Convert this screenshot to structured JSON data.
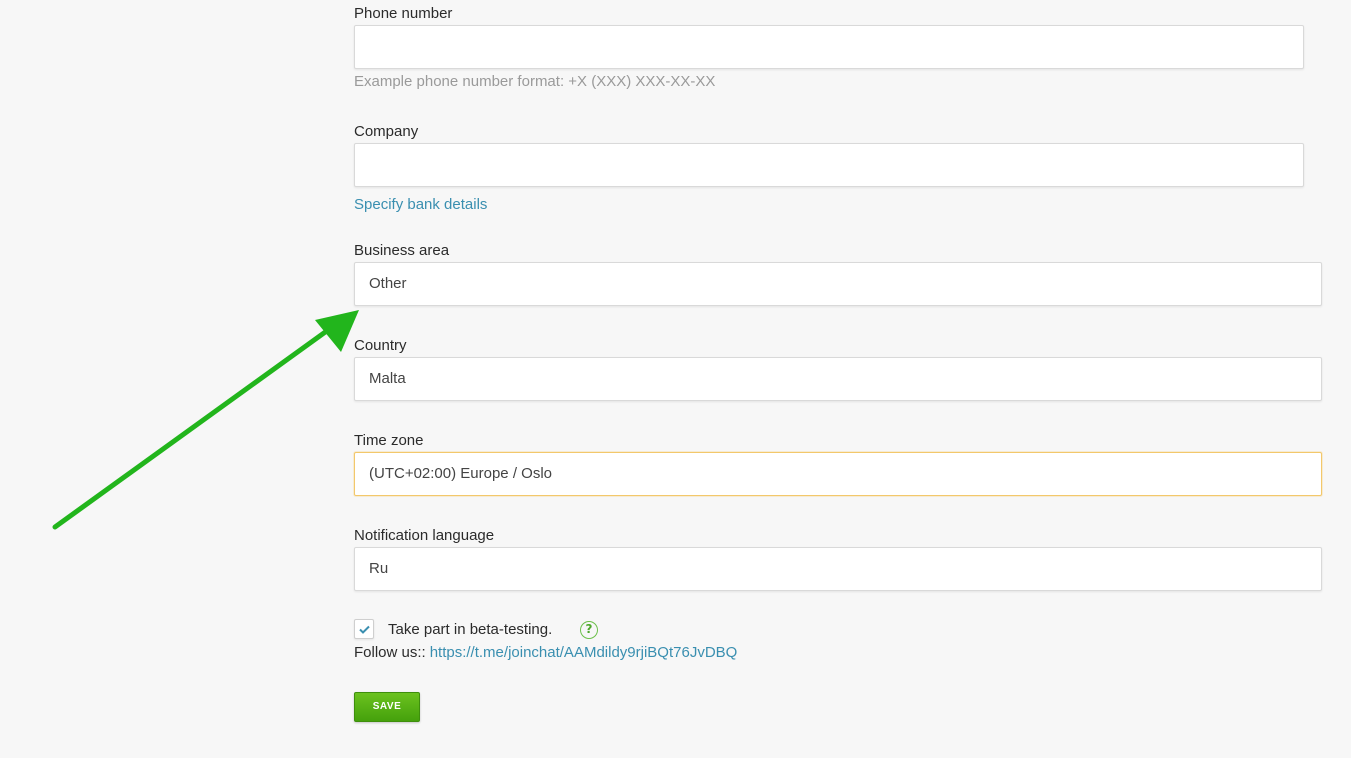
{
  "phone": {
    "label": "Phone number",
    "value": "",
    "hint": "Example phone number format: +X (XXX) XXX-XX-XX"
  },
  "company": {
    "label": "Company",
    "value": "",
    "bank_link": "Specify bank details"
  },
  "business_area": {
    "label": "Business area",
    "value": "Other"
  },
  "country": {
    "label": "Country",
    "value": "Malta"
  },
  "time_zone": {
    "label": "Time zone",
    "value": "(UTC+02:00) Europe / Oslo"
  },
  "notification_language": {
    "label": "Notification language",
    "value": "Ru"
  },
  "beta": {
    "label": "Take part in beta-testing.",
    "checked": true,
    "help_icon": "?"
  },
  "follow": {
    "label": "Follow us::",
    "link": "https://t.me/joinchat/AAMdildy9rjiBQt76JvDBQ"
  },
  "save_button": "SAVE",
  "colors": {
    "arrow": "#22b51c",
    "link": "#3a8fb0",
    "button": "#55b014",
    "focus_border": "#f3c86b"
  },
  "icons": {
    "annotation": "arrow-icon",
    "checkbox": "check-icon",
    "help": "question-circle-icon"
  }
}
